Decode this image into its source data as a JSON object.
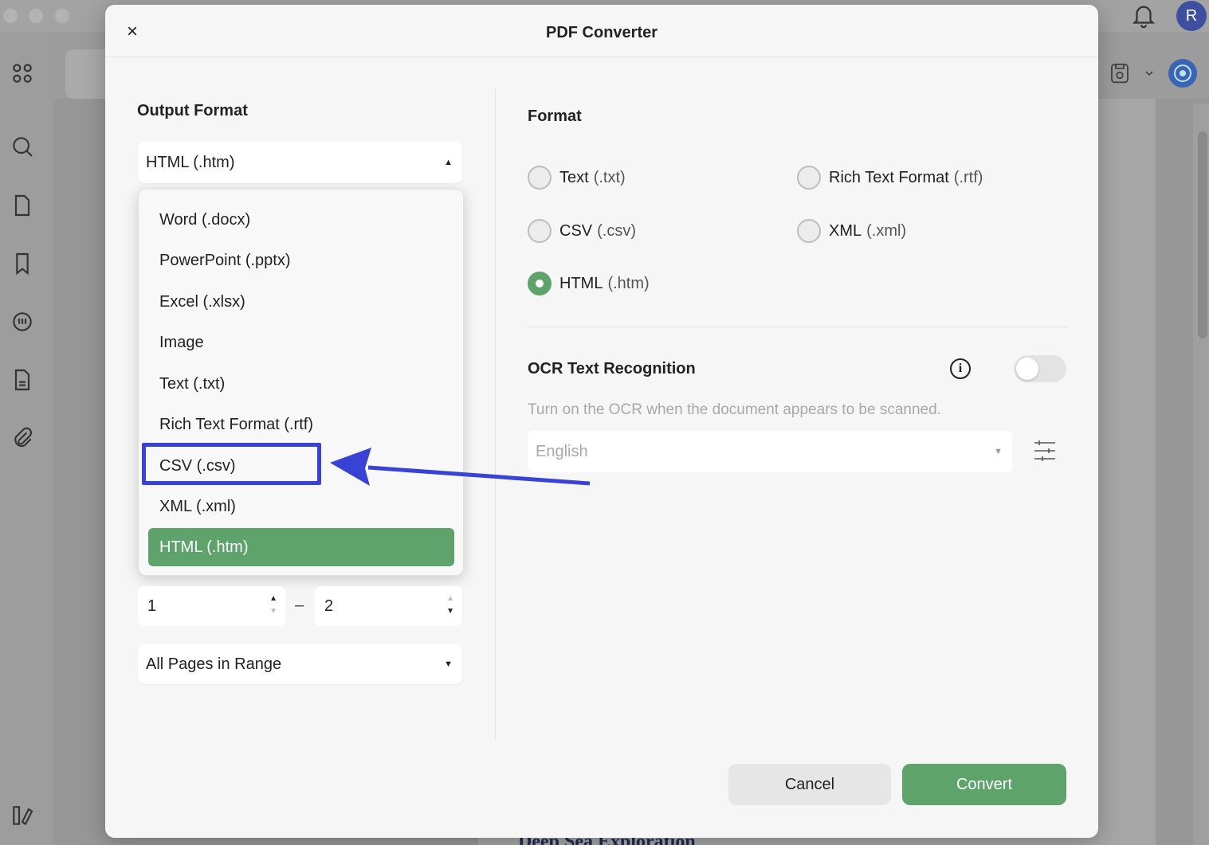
{
  "app": {
    "avatar_initial": "R",
    "doc_heading": "Deep Sea Exploration"
  },
  "dialog": {
    "title": "PDF Converter",
    "close_label": "×"
  },
  "output_format": {
    "title": "Output Format",
    "selected": "HTML (.htm)",
    "options": [
      "Word (.docx)",
      "PowerPoint (.pptx)",
      "Excel (.xlsx)",
      "Image",
      "Text (.txt)",
      "Rich Text Format (.rtf)",
      "CSV (.csv)",
      "XML (.xml)",
      "HTML (.htm)"
    ],
    "highlighted_option": "CSV (.csv)"
  },
  "page_range": {
    "from": "1",
    "to": "2",
    "dash": "–",
    "range_mode": "All Pages in Range"
  },
  "format": {
    "title": "Format",
    "options": [
      {
        "name": "Text",
        "ext": "(.txt)",
        "checked": false
      },
      {
        "name": "Rich Text Format",
        "ext": "(.rtf)",
        "checked": false
      },
      {
        "name": "CSV",
        "ext": "(.csv)",
        "checked": false
      },
      {
        "name": "XML",
        "ext": "(.xml)",
        "checked": false
      },
      {
        "name": "HTML",
        "ext": "(.htm)",
        "checked": true
      }
    ]
  },
  "ocr": {
    "title": "OCR Text Recognition",
    "enabled": false,
    "description": "Turn on the OCR when the document appears to be scanned.",
    "language": "English",
    "info_glyph": "i"
  },
  "buttons": {
    "cancel": "Cancel",
    "convert": "Convert"
  },
  "colors": {
    "accent_green": "#5fa36c",
    "annotation_blue": "#3843d6"
  }
}
